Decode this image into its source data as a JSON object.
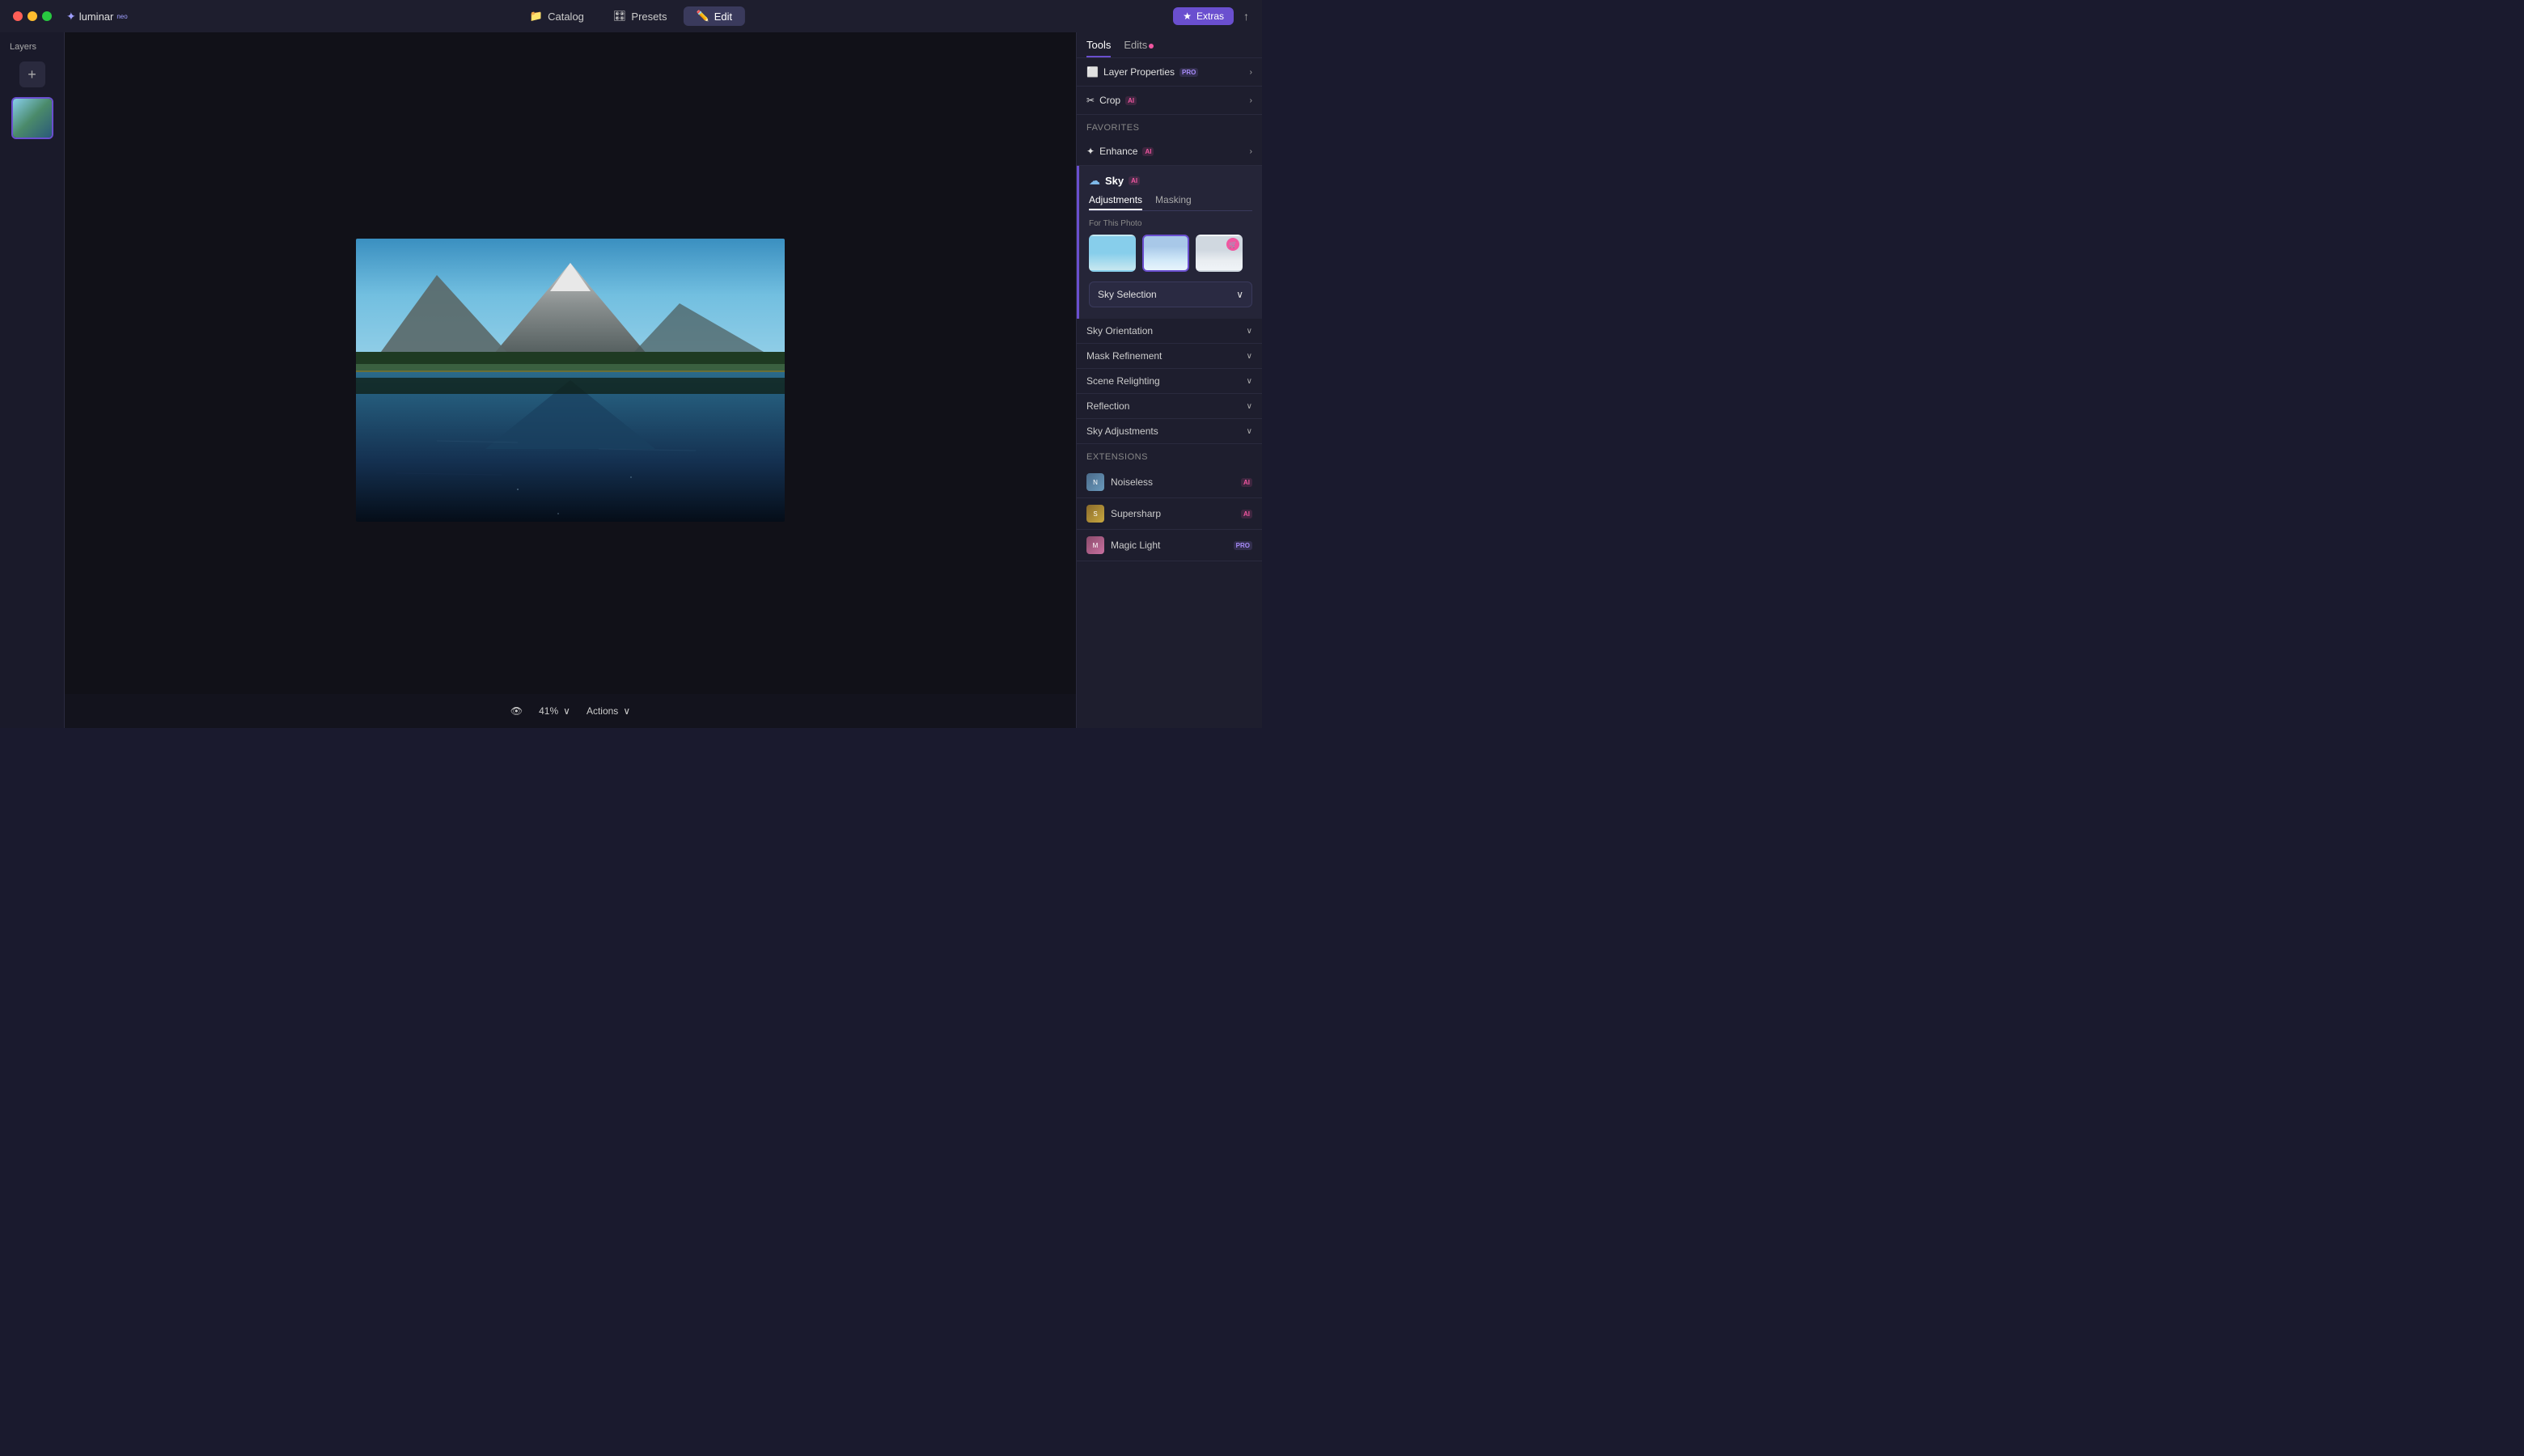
{
  "app": {
    "name": "luminar",
    "superscript": "neo",
    "traffic_lights": [
      "close",
      "minimize",
      "maximize"
    ]
  },
  "titlebar": {
    "nav": [
      {
        "id": "catalog",
        "label": "Catalog",
        "icon": "📁",
        "active": false
      },
      {
        "id": "presets",
        "label": "Presets",
        "icon": "🎛",
        "active": false
      },
      {
        "id": "edit",
        "label": "Edit",
        "icon": "✏️",
        "active": true
      }
    ],
    "extras_label": "Extras",
    "share_icon": "↑"
  },
  "layers_panel": {
    "title": "Layers",
    "add_label": "+"
  },
  "canvas": {
    "zoom": "41%",
    "zoom_chevron": "∨",
    "actions_label": "Actions",
    "actions_chevron": "∨",
    "eye_icon": "👁"
  },
  "right_panel": {
    "tabs": [
      {
        "id": "tools",
        "label": "Tools",
        "active": true,
        "has_dot": false
      },
      {
        "id": "edits",
        "label": "Edits",
        "active": false,
        "has_dot": true
      }
    ],
    "sections": [
      {
        "id": "layer-properties",
        "label": "Layer Properties",
        "badge": "PRO",
        "badge_type": "pro",
        "icon": "⬜",
        "collapsed": false
      },
      {
        "id": "crop",
        "label": "Crop",
        "badge": "AI",
        "badge_type": "ai",
        "icon": "✂",
        "collapsed": false
      }
    ],
    "favorites_label": "Favorites",
    "favorites_sections": [
      {
        "id": "enhance",
        "label": "Enhance",
        "badge": "AI",
        "badge_type": "ai",
        "icon": "✦"
      }
    ],
    "sky": {
      "label": "Sky",
      "badge": "AI",
      "tabs": [
        {
          "id": "adjustments",
          "label": "Adjustments",
          "active": true
        },
        {
          "id": "masking",
          "label": "Masking",
          "active": false
        }
      ],
      "for_photo_label": "For This Photo",
      "thumbnails": [
        {
          "id": "sky1",
          "style": "sky-thumb-1",
          "selected": false
        },
        {
          "id": "sky2",
          "style": "sky-thumb-2",
          "selected": true
        },
        {
          "id": "sky3",
          "style": "sky-thumb-3",
          "selected": false,
          "has_cart": true
        }
      ],
      "dropdown_label": "Sky Selection",
      "dropdown_chevron": "∨",
      "sub_sections": [
        {
          "id": "sky-orientation",
          "label": "Sky Orientation",
          "chevron": "∨"
        },
        {
          "id": "mask-refinement",
          "label": "Mask Refinement",
          "chevron": "∨"
        },
        {
          "id": "scene-relighting",
          "label": "Scene Relighting",
          "chevron": "∨"
        },
        {
          "id": "reflection",
          "label": "Reflection",
          "chevron": "∨"
        },
        {
          "id": "sky-adjustments",
          "label": "Sky Adjustments",
          "chevron": "∨"
        }
      ]
    },
    "extensions_label": "Extensions",
    "extensions": [
      {
        "id": "noiseless",
        "label": "Noiseless",
        "badge": "AI",
        "icon_class": "ext-noiseless-icon"
      },
      {
        "id": "supersharp",
        "label": "Supersharp",
        "badge": "AI",
        "icon_class": "ext-supersharp-icon"
      },
      {
        "id": "magic-light",
        "label": "Magic Light",
        "badge": "PRO",
        "icon_class": "ext-magiclight-icon"
      }
    ]
  }
}
